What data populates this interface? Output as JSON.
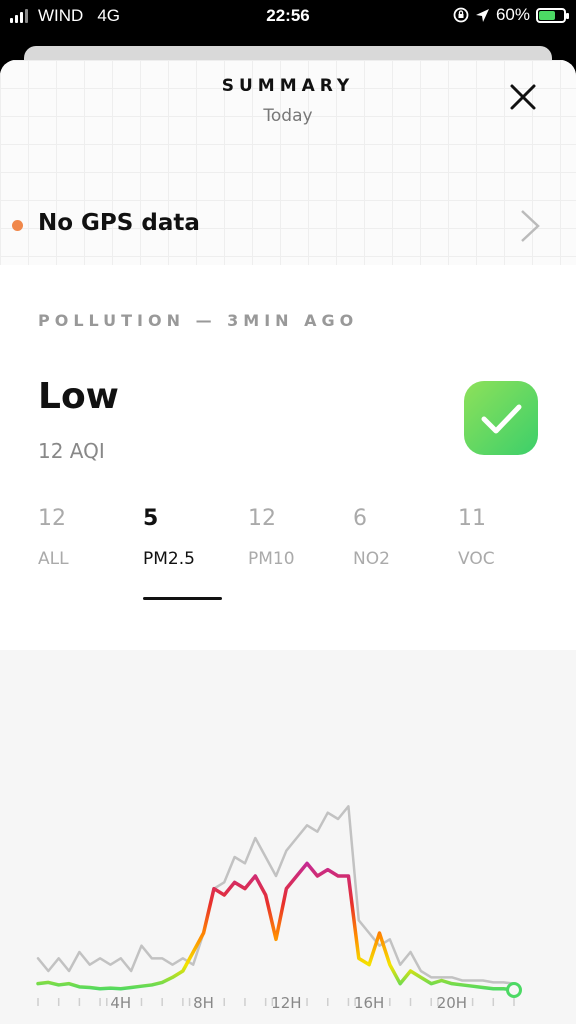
{
  "status_bar": {
    "carrier": "WIND",
    "network": "4G",
    "time": "22:56",
    "battery_percent": "60%"
  },
  "header": {
    "title": "SUMMARY",
    "subtitle": "Today"
  },
  "gps": {
    "text": "No GPS data"
  },
  "pollution": {
    "section_label": "POLLUTION — 3MIN AGO",
    "level": "Low",
    "aqi_text": "12 AQI",
    "tabs": [
      {
        "value": "12",
        "label": "ALL"
      },
      {
        "value": "5",
        "label": "PM2.5"
      },
      {
        "value": "12",
        "label": "PM10"
      },
      {
        "value": "6",
        "label": "NO2"
      },
      {
        "value": "11",
        "label": "VOC"
      }
    ]
  },
  "colors": {
    "accent_orange": "#f0874a",
    "good_green": "#4cd964",
    "badge_green": "#3ccf6a",
    "grey_series": "#c2c2c2"
  },
  "chart_data": {
    "type": "line",
    "x_ticks": [
      "4H",
      "8H",
      "12H",
      "16H",
      "20H"
    ],
    "x": [
      0,
      0.5,
      1,
      1.5,
      2,
      2.5,
      3,
      3.5,
      4,
      4.5,
      5,
      5.5,
      6,
      6.5,
      7,
      7.5,
      8,
      8.5,
      9,
      9.5,
      10,
      10.5,
      11,
      11.5,
      12,
      12.5,
      13,
      13.5,
      14,
      14.5,
      15,
      15.5,
      16,
      16.5,
      17,
      17.5,
      18,
      18.5,
      19,
      19.5,
      20,
      20.5,
      21,
      21.5,
      22,
      22.5,
      23
    ],
    "series": [
      {
        "values": [
          5,
          3,
          5,
          3,
          6,
          4,
          5,
          4,
          5,
          3,
          7,
          5,
          5,
          4,
          5,
          4,
          9,
          16,
          17,
          21,
          20,
          24,
          21,
          18,
          22,
          24,
          26,
          25,
          28,
          27,
          29,
          11,
          9,
          7,
          8,
          4,
          6,
          3,
          2,
          2,
          2,
          1.5,
          1.5,
          1.5,
          1.2,
          1.2,
          1
        ]
      },
      {
        "values": [
          1,
          1.2,
          0.8,
          1,
          0.5,
          0.4,
          0.2,
          0.3,
          0.2,
          0.4,
          0.6,
          0.8,
          1.2,
          2,
          3,
          6,
          9,
          16,
          15,
          17,
          16,
          18,
          15,
          8,
          16,
          18,
          20,
          18,
          19,
          18,
          18,
          5,
          4,
          9,
          4,
          1,
          3,
          2,
          1,
          1.5,
          1,
          0.8,
          0.6,
          0.4,
          0.2,
          0.2,
          0
        ]
      }
    ]
  }
}
